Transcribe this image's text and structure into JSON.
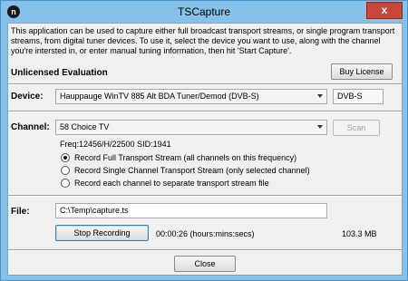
{
  "window": {
    "title": "TSCapture",
    "app_icon": "n",
    "close_glyph": "x"
  },
  "intro_text": "This application can be used to capture either full broadcast transport streams, or single program transport streams, from digital tuner devices. To use it, select the device you want to use, along with the channel you're intersted in, or enter manual tuning information, then hit 'Start Capture'.",
  "license": {
    "status": "Unlicensed Evaluation",
    "buy_label": "Buy License"
  },
  "device": {
    "label": "Device:",
    "selected": "Hauppauge WinTV 885 Alt BDA Tuner/Demod     (DVB-S)",
    "type": "DVB-S"
  },
  "channel": {
    "label": "Channel:",
    "selected": "58    Choice TV",
    "scan_label": "Scan",
    "freq_info": "Freq:12456/H/22500 SID:1941"
  },
  "record_modes": [
    {
      "label": "Record Full Transport Stream (all channels on this frequency)",
      "checked": true
    },
    {
      "label": "Record Single Channel Transport Stream (only selected channel)",
      "checked": false
    },
    {
      "label": "Record each channel to separate transport stream file",
      "checked": false
    }
  ],
  "file": {
    "label": "File:",
    "path": "C:\\Temp\\capture.ts"
  },
  "recording": {
    "button_label": "Stop Recording",
    "elapsed": "00:00:26 (hours:mins:secs)",
    "size": "103.3 MB"
  },
  "footer": {
    "close_label": "Close"
  },
  "colors": {
    "frame": "#86c1ea",
    "close_button": "#c7473a",
    "client_bg": "#f0f0f0"
  }
}
